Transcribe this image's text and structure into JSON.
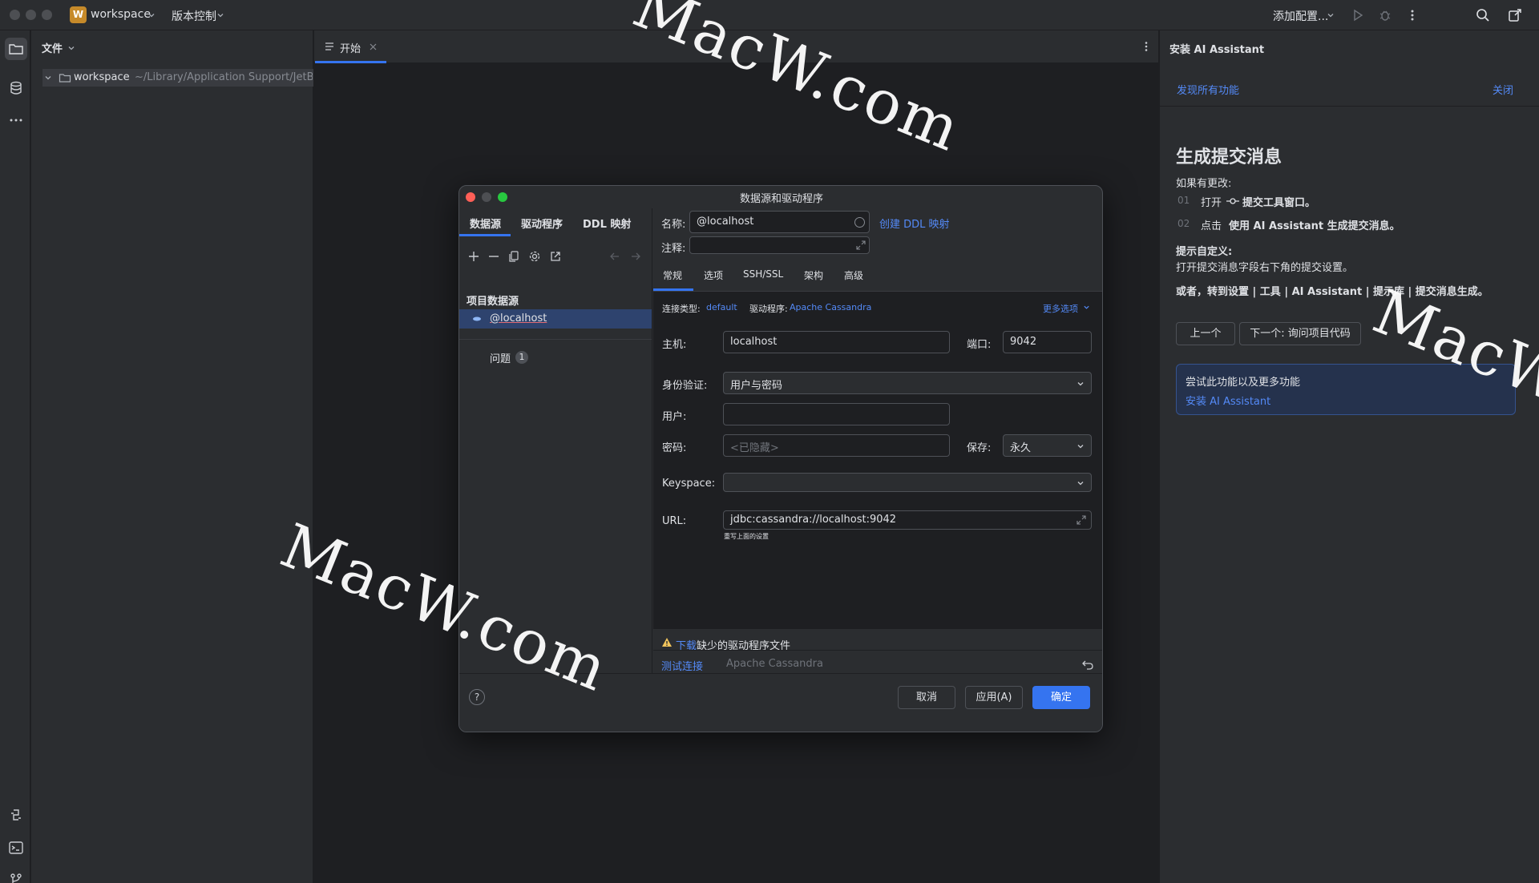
{
  "titlebar": {
    "project_initial": "W",
    "project_name": "workspace",
    "vcs_label": "版本控制",
    "add_config_label": "添加配置..."
  },
  "project_panel": {
    "header": "文件",
    "root_name": "workspace",
    "root_path": "~/Library/Application Support/JetBrains"
  },
  "editor": {
    "tab_label": "开始"
  },
  "right_panel": {
    "title": "安装 AI Assistant",
    "discover_link": "发现所有功能",
    "close_link": "关闭",
    "heading": "生成提交消息",
    "if_changes": "如果有更改:",
    "step1_num": "01",
    "step1_a": "打开",
    "step1_b": "提交工具窗口。",
    "step2_num": "02",
    "step2_a": "点击",
    "step2_b": "使用 AI Assistant 生成提交消息。",
    "customize_title": "提示自定义:",
    "customize_text": "打开提交消息字段右下角的提交设置。",
    "or_text": "或者，转到设置 | 工具 | AI Assistant | 提示库 | 提交消息生成。",
    "prev_button": "上一个",
    "next_button": "下一个: 询问项目代码",
    "promo_text": "尝试此功能以及更多功能",
    "promo_link": "安装 AI Assistant"
  },
  "dialog": {
    "title": "数据源和驱动程序",
    "tabs": [
      "数据源",
      "驱动程序",
      "DDL 映射"
    ],
    "section_title": "项目数据源",
    "datasource_item": "@localhost",
    "problems_label": "问题",
    "problems_count": "1",
    "name_label": "名称:",
    "name_value": "@localhost",
    "create_ddl_link": "创建 DDL 映射",
    "comment_label": "注释:",
    "subtabs": [
      "常规",
      "选项",
      "SSH/SSL",
      "架构",
      "高级"
    ],
    "conn_type_label": "连接类型:",
    "conn_type_value": "default",
    "driver_label": "驱动程序:",
    "driver_value": "Apache Cassandra",
    "more_options": "更多选项",
    "host_label": "主机:",
    "host_value": "localhost",
    "port_label": "端口:",
    "port_value": "9042",
    "auth_label": "身份验证:",
    "auth_value": "用户与密码",
    "user_label": "用户:",
    "password_label": "密码:",
    "password_placeholder": "<已隐藏>",
    "save_label": "保存:",
    "save_value": "永久",
    "keyspace_label": "Keyspace:",
    "url_label": "URL:",
    "url_value": "jdbc:cassandra://localhost:9042",
    "url_hint": "重写上面的设置",
    "warning_link": "下载",
    "warning_text": "缺少的驱动程序文件",
    "test_connection": "测试连接",
    "test_driver": "Apache Cassandra",
    "cancel_button": "取消",
    "apply_button": "应用(A)",
    "ok_button": "确定"
  },
  "watermark": "MacW.com",
  "colors": {
    "accent": "#3574f0",
    "link": "#548af7",
    "warning": "#f2c55c",
    "close_red": "#ff5f57",
    "minimize_yellow": "#febc2e",
    "zoom_green": "#28c840"
  }
}
